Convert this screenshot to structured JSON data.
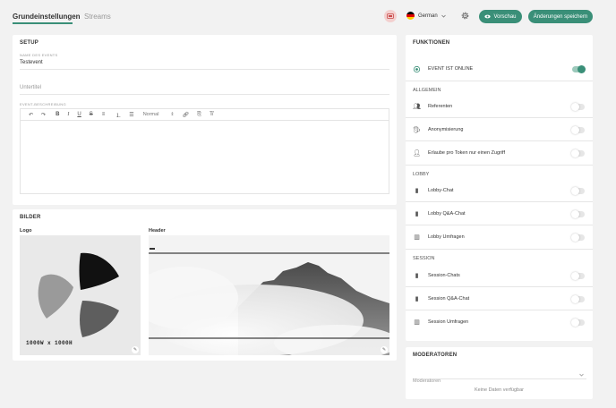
{
  "tabs": {
    "settings": "Grundeinstellungen",
    "streams": "Streams"
  },
  "language": "German",
  "buttons": {
    "preview": "Vorschau",
    "save": "Änderungen speichern"
  },
  "setup": {
    "title": "SETUP",
    "name_label": "NAME DES EVENTS",
    "name_value": "Testevent",
    "subtitle_placeholder": "Untertitel",
    "description_label": "EVENT-BESCHREIBUNG",
    "format_select": "Normal"
  },
  "images": {
    "title": "BILDER",
    "logo_label": "Logo",
    "header_label": "Header",
    "logo_size": "1000W x 1000H"
  },
  "functions": {
    "title": "FUNKTIONEN",
    "online": {
      "label": "EVENT IST ONLINE",
      "on": true
    },
    "general": {
      "title": "ALLGEMEIN",
      "items": [
        {
          "label": "Referenten",
          "on": false
        },
        {
          "label": "Anonymisierung",
          "on": false
        },
        {
          "label": "Erlaube pro Token nur einen Zugriff",
          "on": false
        }
      ]
    },
    "lobby": {
      "title": "LOBBY",
      "items": [
        {
          "label": "Lobby-Chat",
          "on": false
        },
        {
          "label": "Lobby Q&A-Chat",
          "on": false
        },
        {
          "label": "Lobby Umfragen",
          "on": false
        }
      ]
    },
    "session": {
      "title": "SESSION",
      "items": [
        {
          "label": "Session-Chats",
          "on": false
        },
        {
          "label": "Session Q&A-Chat",
          "on": false
        },
        {
          "label": "Session Umfragen",
          "on": false
        }
      ]
    }
  },
  "moderators": {
    "title": "MODERATOREN",
    "select_placeholder": "Moderatoren",
    "empty": "Keine Daten verfügbar"
  },
  "colors": {
    "accent": "#3a8f78",
    "background": "#f2f2f2"
  }
}
